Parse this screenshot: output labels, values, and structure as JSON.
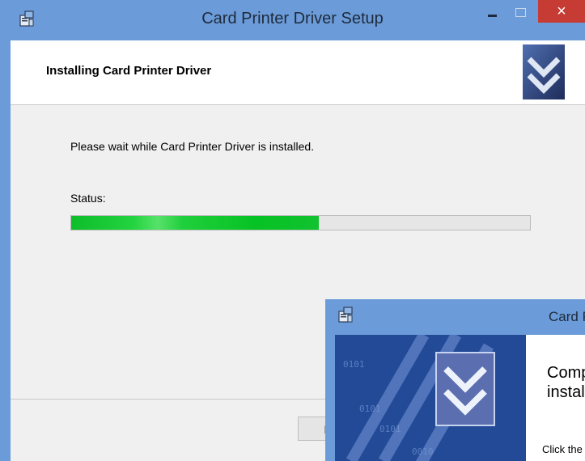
{
  "window": {
    "title": "Card Printer Driver Setup",
    "close_glyph": "×"
  },
  "header": {
    "title": "Installing Card Printer Driver"
  },
  "body": {
    "message": "Please wait while Card Printer Driver is installed.",
    "status_label": "Status:",
    "progress": 0.54
  },
  "footer": {
    "back_label": "B"
  },
  "dialog2": {
    "title_partial": "Card Pri",
    "heading_line1": "Comp",
    "heading_line2": "instal",
    "click_text": "Click the"
  },
  "colors": {
    "titlebar": "#6b9bd9",
    "close": "#c63c35",
    "progress_fill": "#0dbd2a",
    "banner": "#234a97"
  },
  "icons": [
    "setup-app-icon",
    "minimize-icon",
    "maximize-icon",
    "close-icon",
    "installer-logo-icon"
  ]
}
